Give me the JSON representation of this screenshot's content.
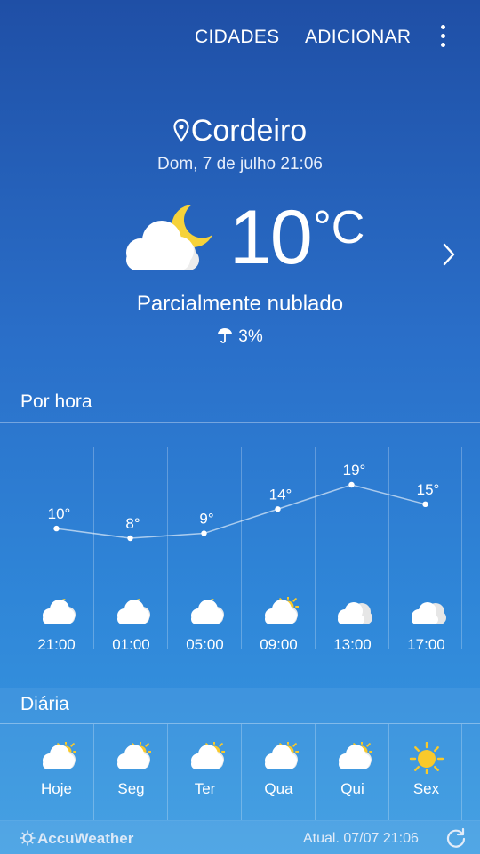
{
  "topbar": {
    "cities_label": "CIDADES",
    "add_label": "ADICIONAR",
    "more_icon": "more-vert-icon"
  },
  "current": {
    "location": "Cordeiro",
    "datetime": "Dom, 7 de julho 21:06",
    "temperature": "10",
    "unit": "°C",
    "condition": "Parcialmente nublado",
    "precipitation": "3%",
    "icon": "partly-cloudy-night-icon"
  },
  "hourly": {
    "title": "Por hora",
    "items": [
      {
        "time": "21:00",
        "temp": 10,
        "temp_label": "10°",
        "icon": "partly-cloudy-night-icon"
      },
      {
        "time": "01:00",
        "temp": 8,
        "temp_label": "8°",
        "icon": "partly-cloudy-night-icon"
      },
      {
        "time": "05:00",
        "temp": 9,
        "temp_label": "9°",
        "icon": "partly-cloudy-night-icon"
      },
      {
        "time": "09:00",
        "temp": 14,
        "temp_label": "14°",
        "icon": "partly-sunny-icon"
      },
      {
        "time": "13:00",
        "temp": 19,
        "temp_label": "19°",
        "icon": "cloudy-icon"
      },
      {
        "time": "17:00",
        "temp": 15,
        "temp_label": "15°",
        "icon": "cloudy-icon"
      }
    ]
  },
  "daily": {
    "title": "Diária",
    "items": [
      {
        "day": "Hoje",
        "icon": "partly-sunny-icon"
      },
      {
        "day": "Seg",
        "icon": "partly-sunny-icon"
      },
      {
        "day": "Ter",
        "icon": "partly-sunny-icon"
      },
      {
        "day": "Qua",
        "icon": "partly-sunny-icon"
      },
      {
        "day": "Qui",
        "icon": "partly-sunny-icon"
      },
      {
        "day": "Sex",
        "icon": "sunny-icon"
      }
    ]
  },
  "footer": {
    "brand": "AccuWeather",
    "updated": "Atual. 07/07  21:06"
  },
  "colors": {
    "sun": "#f9c92b",
    "moon": "#f6d23a",
    "cloud": "#ffffff"
  }
}
